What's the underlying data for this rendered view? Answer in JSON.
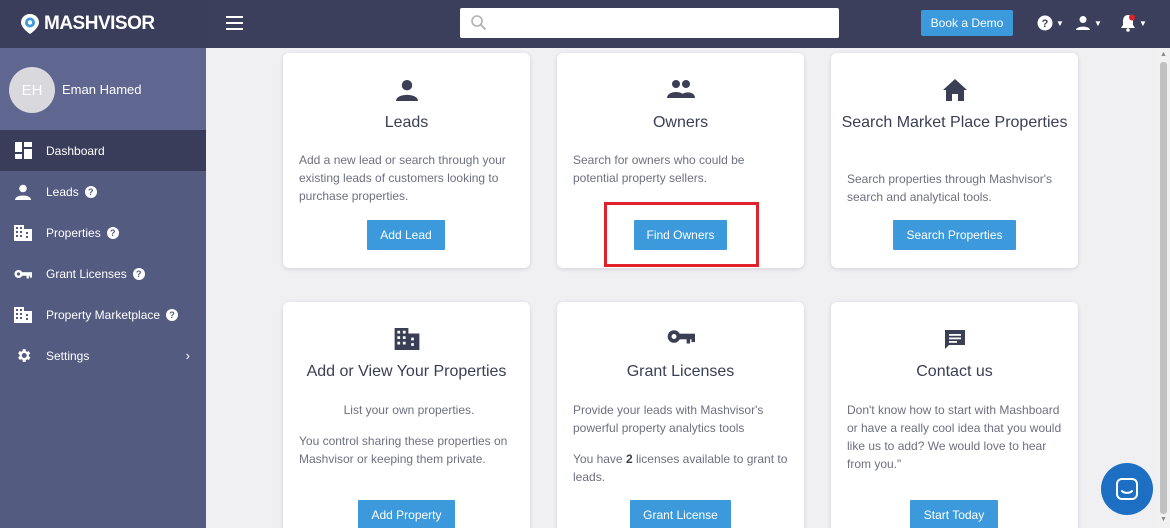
{
  "brand": {
    "name": "MASHVISOR"
  },
  "header": {
    "search_placeholder": "",
    "demo_label": "Book a Demo",
    "icons": [
      "help-icon",
      "user-icon",
      "notification-bell-icon"
    ]
  },
  "sidebar": {
    "avatar_initials": "EH",
    "user_name": "Eman Hamed",
    "items": [
      {
        "label": "Dashboard",
        "icon": "dashboard-icon",
        "active": true
      },
      {
        "label": "Leads",
        "icon": "person-icon",
        "help": true
      },
      {
        "label": "Properties",
        "icon": "building-icon",
        "help": true
      },
      {
        "label": "Grant Licenses",
        "icon": "key-icon",
        "help": true
      },
      {
        "label": "Property Marketplace",
        "icon": "building-icon",
        "help": true
      },
      {
        "label": "Settings",
        "icon": "gear-icon",
        "chevron": true
      }
    ]
  },
  "cards": {
    "leads": {
      "title": "Leads",
      "text": "Add a new lead or search through your existing leads of customers looking to purchase properties.",
      "button": "Add Lead"
    },
    "owners": {
      "title": "Owners",
      "text": "Search for owners who could be potential property sellers.",
      "button": "Find Owners"
    },
    "market": {
      "title": "Search Market Place Properties",
      "text": "Search properties through Mashvisor's search and analytical tools.",
      "button": "Search Properties"
    },
    "properties": {
      "title": "Add or View Your Properties",
      "text1": "List your own properties.",
      "text2": "You control sharing these properties on Mashvisor or keeping them private.",
      "button": "Add Property"
    },
    "licenses": {
      "title": "Grant Licenses",
      "text1": "Provide your leads with Mashvisor's powerful property analytics tools",
      "text2_pre": "You have ",
      "text2_count": "2",
      "text2_post": " licenses available to grant to leads.",
      "button": "Grant License"
    },
    "contact": {
      "title": "Contact us",
      "text": "Don't know how to start with Mashboard or have a really cool idea that you would like us to add? We would love to hear from you.\"",
      "button": "Start Today"
    }
  },
  "colors": {
    "accent": "#3b99dc",
    "topbar": "#3b3f5c",
    "sidebar": "#545b80",
    "highlight": "#e0202a"
  }
}
